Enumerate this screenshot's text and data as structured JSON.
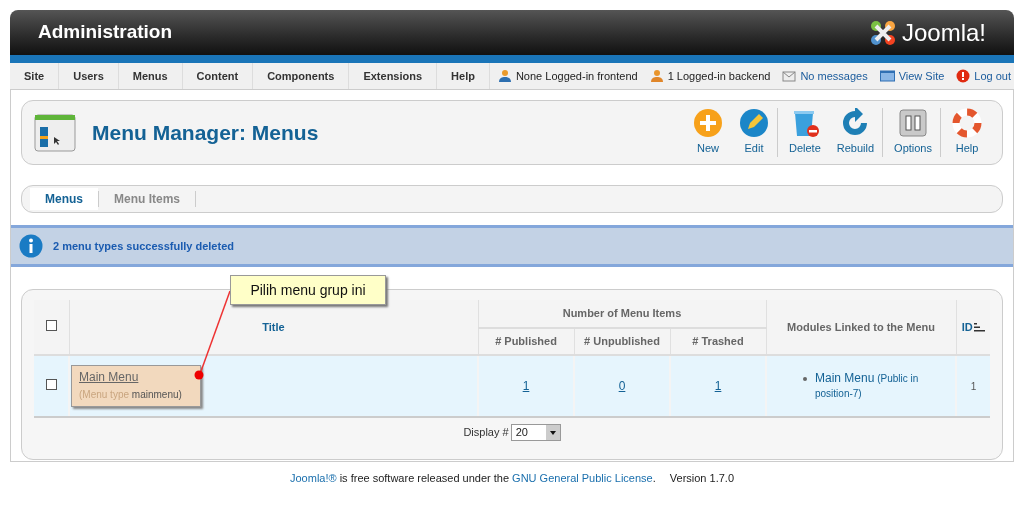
{
  "header": {
    "title": "Administration",
    "logo_text": "Joomla!"
  },
  "menu": [
    {
      "label": "Site"
    },
    {
      "label": "Users"
    },
    {
      "label": "Menus"
    },
    {
      "label": "Content"
    },
    {
      "label": "Components"
    },
    {
      "label": "Extensions"
    },
    {
      "label": "Help"
    }
  ],
  "status": [
    {
      "kind": "users-front",
      "label": "None Logged-in frontend"
    },
    {
      "kind": "users-back",
      "label": "1 Logged-in backend"
    },
    {
      "kind": "messages",
      "label": "No messages"
    },
    {
      "kind": "view",
      "label": "View Site"
    },
    {
      "kind": "logout",
      "label": "Log out"
    }
  ],
  "page_title": "Menu Manager: Menus",
  "toolbar": [
    {
      "kind": "new",
      "label": "New",
      "separator_after": false
    },
    {
      "kind": "edit",
      "label": "Edit",
      "separator_after": true
    },
    {
      "kind": "delete",
      "label": "Delete",
      "separator_after": false
    },
    {
      "kind": "rebuild",
      "label": "Rebuild",
      "separator_after": true
    },
    {
      "kind": "options",
      "label": "Options",
      "separator_after": true
    },
    {
      "kind": "help",
      "label": "Help",
      "separator_after": false
    }
  ],
  "tabs": [
    {
      "label": "Menus",
      "selected": true
    },
    {
      "label": "Menu Items",
      "selected": false
    }
  ],
  "message": "2 menu types successfully deleted",
  "table": {
    "select_all_checked": false,
    "title_header": "Title",
    "group_header": "Number of Menu Items",
    "sub_headers": [
      "# Published",
      "# Unpublished",
      "# Trashed"
    ],
    "modules_header": "Modules Linked to the Menu",
    "id_header": "ID",
    "rows": [
      {
        "checked": false,
        "title": "Main Menu",
        "type_label": "(Menu type",
        "type_value": "mainmenu)",
        "counts": [
          "1",
          "0",
          "1"
        ],
        "module": "Main Menu",
        "module_detail": "(Public in position-7)",
        "id": "1"
      }
    ]
  },
  "display": {
    "label": "Display #",
    "value": "20"
  },
  "callout": "Pilih menu grup ini",
  "footer": {
    "link1": "Joomla!®",
    "middle": " is free software released under the ",
    "link2": "GNU General Public License",
    "end": ".",
    "version": "Version 1.7.0"
  }
}
